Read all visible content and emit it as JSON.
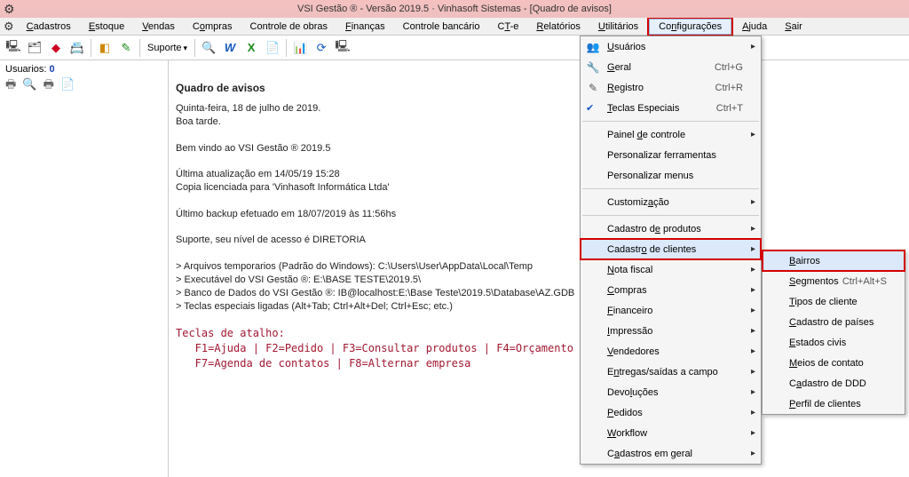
{
  "title": "VSI Gestão ® - Versão 2019.5 · Vinhasoft Sistemas  -  [Quadro de avisos]",
  "menubar": {
    "cadastros": "Cadastros",
    "estoque": "Estoque",
    "vendas": "Vendas",
    "compras": "Compras",
    "controle_obras": "Controle de obras",
    "financas": "Finanças",
    "controle_bancario": "Controle bancário",
    "cte": "CT-e",
    "relatorios": "Relatórios",
    "utilitarios": "Utilitários",
    "configuracoes": "Configurações",
    "ajuda": "Ajuda",
    "sair": "Sair"
  },
  "toolbar": {
    "suporte": "Suporte"
  },
  "side": {
    "usuarios_label": "Usuarios:",
    "usuarios_count": "0"
  },
  "main": {
    "heading": "Quadro de avisos",
    "line_date": "Quinta-feira, 18 de julho de 2019.",
    "line_greet": "Boa tarde.",
    "line_welcome": "Bem vindo ao VSI Gestão ® 2019.5",
    "line_update": "Última atualização em 14/05/19 15:28",
    "line_copy": "Copia licenciada para 'Vinhasoft Informática Ltda'",
    "line_backup": "Último backup efetuado em 18/07/2019 às 11:56hs",
    "line_support": "Suporte, seu nível de acesso é DIRETORIA",
    "line_temp": "> Arquivos temporarios (Padrão do Windows): C:\\Users\\User\\AppData\\Local\\Temp",
    "line_exec": "> Executável do VSI Gestão ®: E:\\BASE TESTE\\2019.5\\",
    "line_db": "> Banco de Dados do VSI Gestão ®: IB@localhost:E:\\Base Teste\\2019.5\\Database\\AZ.GDB",
    "line_teclas": "> Teclas especiais ligadas (Alt+Tab; Ctrl+Alt+Del; Ctrl+Esc; etc.)",
    "teclas_title": "Teclas de atalho:",
    "teclas_l1": "   F1=Ajuda | F2=Pedido | F3=Consultar produtos | F4=Orçamento",
    "teclas_l2": "   F7=Agenda de contatos | F8=Alternar empresa"
  },
  "menu1": {
    "usuarios": "Usuários",
    "geral": "Geral",
    "geral_sc": "Ctrl+G",
    "registro": "Registro",
    "registro_sc": "Ctrl+R",
    "teclas": "Teclas Especiais",
    "teclas_sc": "Ctrl+T",
    "painel": "Painel de controle",
    "pers_ferr": "Personalizar ferramentas",
    "pers_menu": "Personalizar menus",
    "custom": "Customização",
    "cad_prod": "Cadastro de produtos",
    "cad_cli": "Cadastro de clientes",
    "nota": "Nota fiscal",
    "compras": "Compras",
    "financeiro": "Financeiro",
    "impressao": "Impressão",
    "vendedores": "Vendedores",
    "entregas": "Entregas/saídas a campo",
    "devolucoes": "Devoluções",
    "pedidos": "Pedidos",
    "workflow": "Workflow",
    "cad_geral": "Cadastros em geral"
  },
  "menu2": {
    "bairros": "Bairros",
    "segmentos": "Segmentos",
    "segmentos_sc": "Ctrl+Alt+S",
    "tipos": "Tipos de cliente",
    "paises": "Cadastro de países",
    "estados": "Estados civis",
    "meios": "Meios de contato",
    "ddd": "Cadastro de DDD",
    "perfil": "Perfil de clientes"
  }
}
